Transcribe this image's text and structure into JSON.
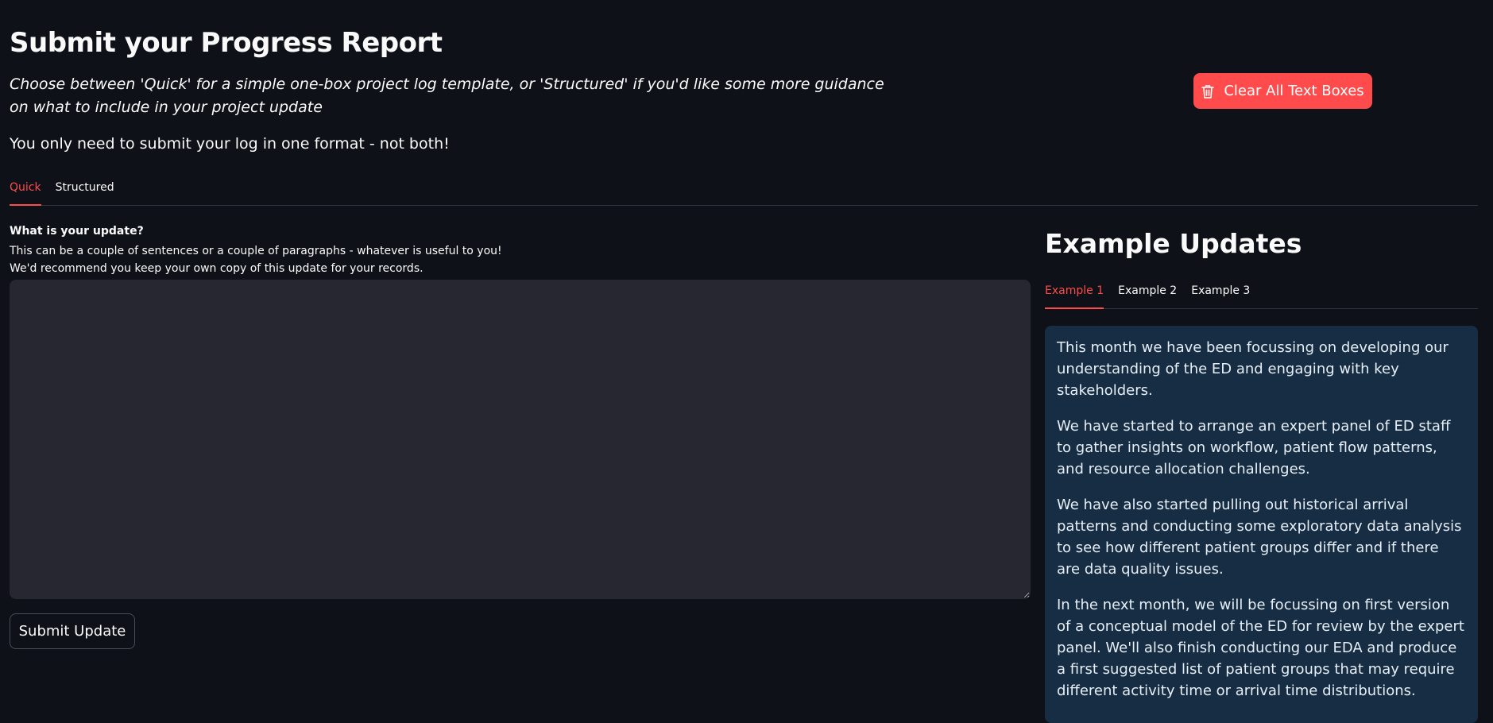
{
  "header": {
    "title": "Submit your Progress Report",
    "intro": "Choose between 'Quick' for a simple one-box project log template, or 'Structured' if you'd like some more guidance on what to include in your project update",
    "note": "You only need to submit your log in one format - not both!"
  },
  "clear_button": {
    "label": "Clear All Text Boxes",
    "icon": "trash-icon",
    "color": "#ff4b4b"
  },
  "main_tabs": [
    {
      "label": "Quick",
      "active": true
    },
    {
      "label": "Structured",
      "active": false
    }
  ],
  "quick_form": {
    "label": "What is your update?",
    "help_line1": "This can be a couple of sentences or a couple of paragraphs - whatever is useful to you!",
    "help_line2": "We'd recommend you keep your own copy of this update for your records.",
    "value": "",
    "submit_label": "Submit Update"
  },
  "examples": {
    "heading": "Example Updates",
    "tabs": [
      {
        "label": "Example 1",
        "active": true
      },
      {
        "label": "Example 2",
        "active": false
      },
      {
        "label": "Example 3",
        "active": false
      }
    ],
    "paragraphs": [
      "This month we have been focussing on developing our understanding of the ED and engaging with key stakeholders.",
      "We have started to arrange an expert panel of ED staff to gather insights on workflow, patient flow patterns, and resource allocation challenges.",
      "We have also started pulling out historical arrival patterns and conducting some exploratory data analysis to see how different patient groups differ and if there are data quality issues.",
      "In the next month, we will be focussing on first version of a conceptual model of the ED for review by the expert panel. We'll also finish conducting our EDA and produce a first suggested list of patient groups that may require different activity time or arrival time distributions."
    ]
  },
  "colors": {
    "background": "#0e1117",
    "accent": "#ff4b4b",
    "input_bg": "#262730",
    "example_bg": "#172d43"
  }
}
